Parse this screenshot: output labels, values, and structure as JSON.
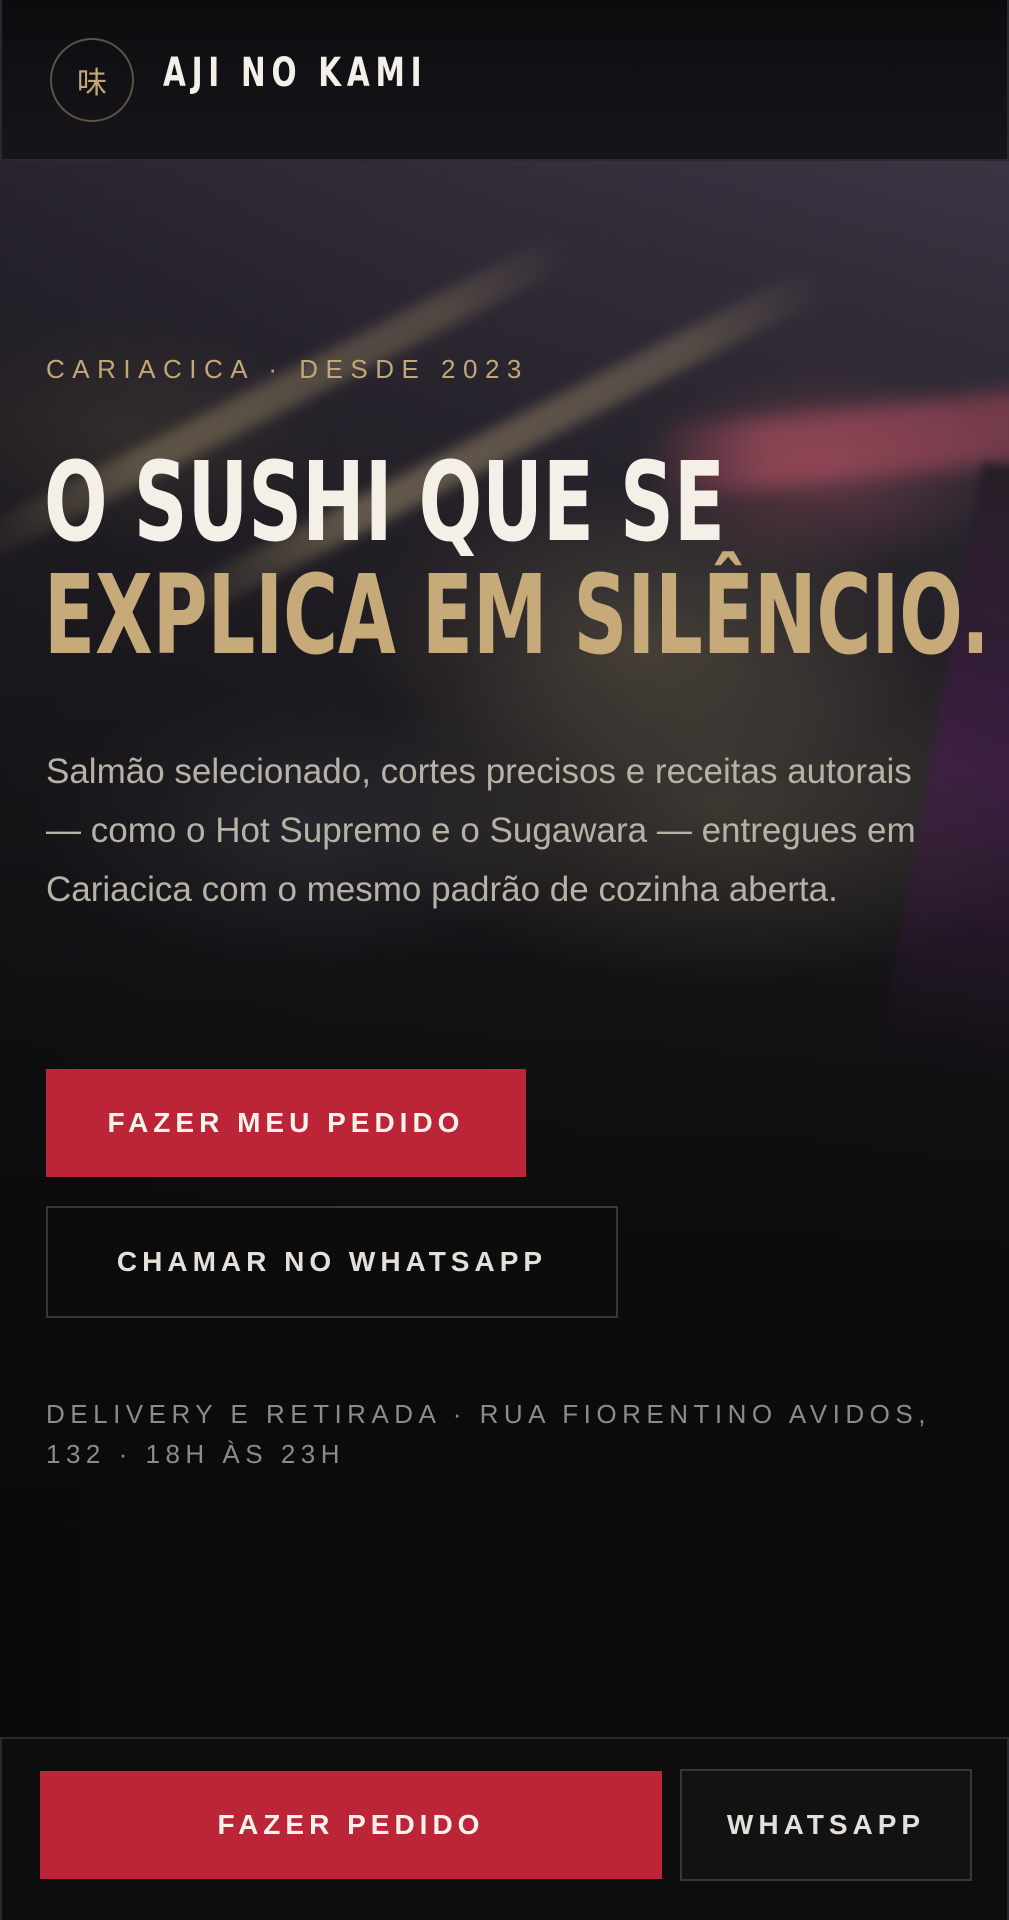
{
  "header": {
    "logo_glyph": "味",
    "brand_name": "AJI NO KAMI"
  },
  "hero": {
    "eyebrow": "CARIACICA · DESDE 2023",
    "headline_line1": "O SUSHI QUE SE",
    "headline_line2": "EXPLICA EM SILÊNCIO.",
    "lede": "Salmão selecionado, cortes precisos e receitas autorais — como o Hot Supremo e o Sugawara — entregues em Cariacica com o mesmo padrão de cozinha aberta.",
    "primary_cta": "FAZER MEU PEDIDO",
    "secondary_cta": "CHAMAR NO WHATSAPP",
    "info": "DELIVERY E RETIRADA · RUA FIORENTINO AVIDOS, 132 · 18H ÀS 23H"
  },
  "bottom_bar": {
    "order_label": "FAZER PEDIDO",
    "whatsapp_label": "WHATSAPP"
  },
  "colors": {
    "accent_red": "#bc2438",
    "gold": "#c6aa7a",
    "background": "#0b0b0c",
    "text_light": "#f4f0e8"
  }
}
